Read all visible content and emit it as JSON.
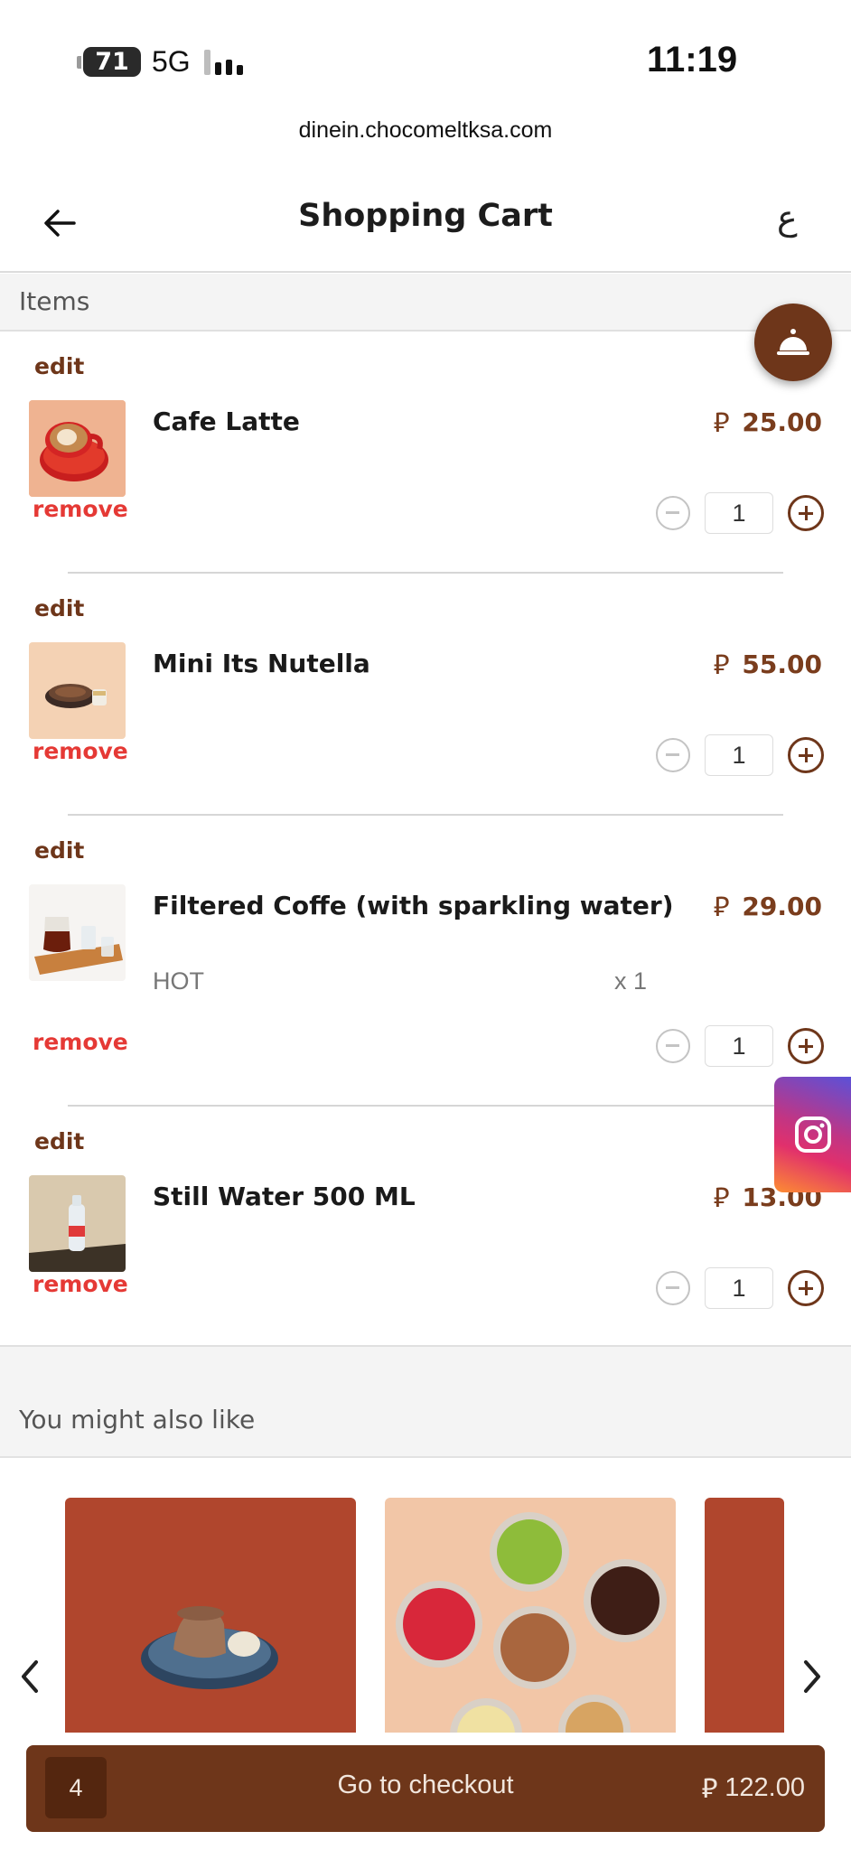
{
  "status_bar": {
    "battery": "71",
    "network": "5G",
    "time": "11:19"
  },
  "browser": {
    "url": "dinein.chocomeltksa.com"
  },
  "header": {
    "title": "Shopping Cart",
    "language_toggle": "ع"
  },
  "items_section": {
    "label": "Items"
  },
  "currency_symbol": "⃁",
  "cart_items": [
    {
      "edit": "edit",
      "name": "Cafe Latte",
      "price": "25.00",
      "remove": "remove",
      "quantity": "1"
    },
    {
      "edit": "edit",
      "name": "Mini Its Nutella",
      "price": "55.00",
      "remove": "remove",
      "quantity": "1"
    },
    {
      "edit": "edit",
      "name": "Filtered Coffe (with sparkling water)",
      "price": "29.00",
      "remove": "remove",
      "quantity": "1",
      "option": "HOT",
      "option_qty": "x 1"
    },
    {
      "edit": "edit",
      "name": "Still Water 500 ML",
      "price": "13.00",
      "remove": "remove",
      "quantity": "1"
    }
  ],
  "suggestions": {
    "title": "You might also like"
  },
  "checkout": {
    "count": "4",
    "label": "Go to checkout",
    "total": "122.00"
  },
  "colors": {
    "brand": "#6e361a",
    "remove": "#e53935",
    "price": "#7a3d1d"
  }
}
